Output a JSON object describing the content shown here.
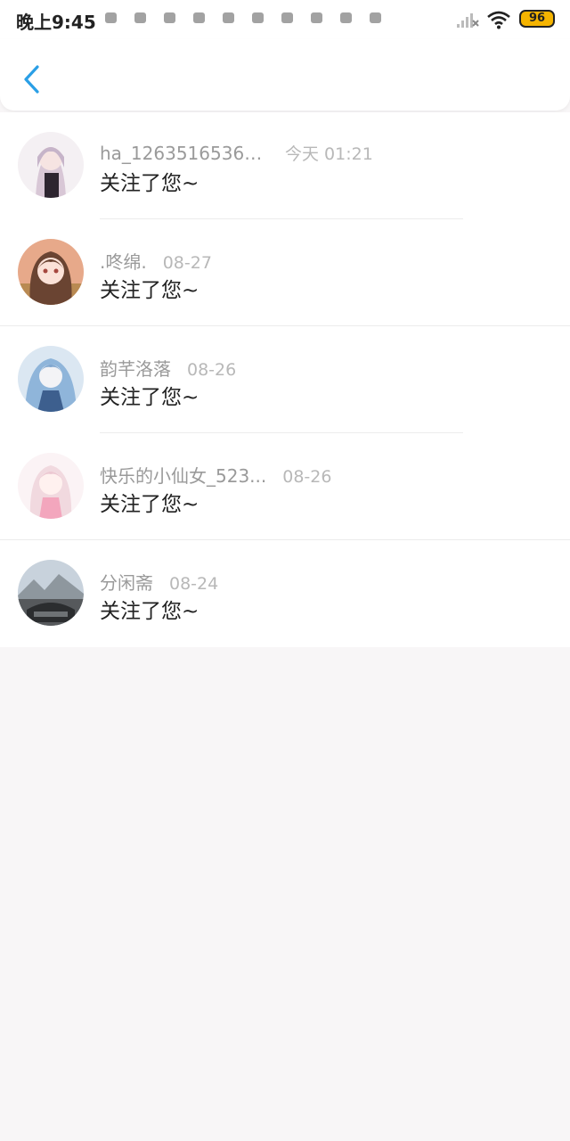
{
  "status_bar": {
    "time": "晚上9:45",
    "battery": "96"
  },
  "header": {
    "back_icon": "chevron-left-icon",
    "accent_color": "#2a9fe6"
  },
  "notifications": [
    {
      "username": "ha_126351653624...",
      "timestamp": "今天 01:21",
      "message": "关注了您~"
    },
    {
      "username": ".咚绵.",
      "timestamp": "08-27",
      "message": "关注了您~"
    },
    {
      "username": "韵芊洛落",
      "timestamp": "08-26",
      "message": "关注了您~"
    },
    {
      "username": "快乐的小仙女_523...",
      "timestamp": "08-26",
      "message": "关注了您~"
    },
    {
      "username": "分闲斋",
      "timestamp": "08-24",
      "message": "关注了您~"
    }
  ]
}
